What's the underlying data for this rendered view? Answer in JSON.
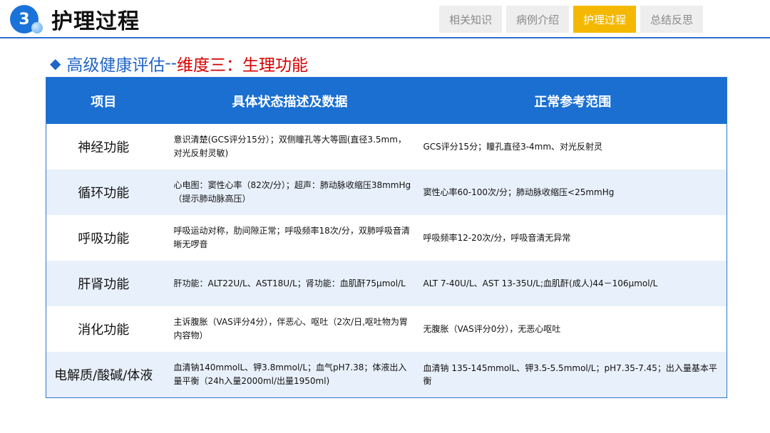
{
  "header": {
    "section_number": "3",
    "title": "护理过程",
    "tabs": [
      {
        "label": "相关知识",
        "active": false
      },
      {
        "label": "病例介绍",
        "active": false
      },
      {
        "label": "护理过程",
        "active": true
      },
      {
        "label": "总结反思",
        "active": false
      }
    ]
  },
  "subtitle": {
    "part_a": "高级健康评估",
    "separator": "--",
    "part_b": "维度三：生理功能"
  },
  "table": {
    "headers": [
      "项目",
      "具体状态描述及数据",
      "正常参考范围"
    ],
    "rows": [
      {
        "item": "神经功能",
        "desc": "意识清楚(GCS评分15分）；双侧瞳孔等大等圆(直径3.5mm，对光反射灵敏)",
        "ref": "GCS评分15分；瞳孔直径3-4mm、对光反射灵"
      },
      {
        "item": "循环功能",
        "desc": "心电图：窦性心率（82次/分）；超声：肺动脉收缩压38mmHg（提示肺动脉高压）",
        "ref": "窦性心率60-100次/分；肺动脉收缩压<25mmHg"
      },
      {
        "item": "呼吸功能",
        "desc": "呼吸运动对称，肋间隙正常；呼吸频率18次/分，双肺呼吸音清晰无啰音",
        "ref": "呼吸频率12-20次/分，呼吸音清无异常"
      },
      {
        "item": "肝肾功能",
        "desc": "肝功能：ALT22U/L、AST18U/L；肾功能：血肌酐75μmol/L",
        "ref": "ALT 7-40U/L、AST 13-35U/L;血肌酐(成人)44－106μmol/L"
      },
      {
        "item": "消化功能",
        "desc": "主诉腹胀（VAS评分4分），伴恶心、呕吐（2次/日,呕吐物为胃内容物）",
        "ref": "无腹胀（VAS评分0分），无恶心呕吐"
      },
      {
        "item": "电解质/酸碱/体液",
        "desc": "血清钠140mmolL、钾3.8mmol/L；血气pH7.38；体液出入量平衡（24h入量2000ml/出量1950ml)",
        "ref": "血清钠 135-145mmolL、钾3.5-5.5mmol/L；pH7.35-7.45；出入量基本平衡"
      }
    ]
  },
  "colors": {
    "accent_blue": "#1a6fd1",
    "active_tab": "#f5b800",
    "highlight_red": "#d40000",
    "row_alt": "#e8f1fb"
  }
}
